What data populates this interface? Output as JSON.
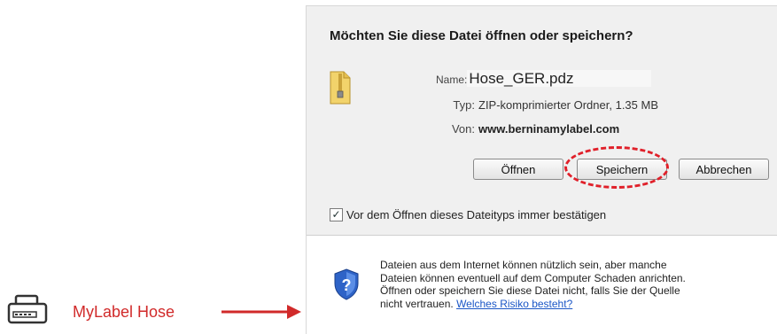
{
  "dialog": {
    "question": "Möchten Sie diese Datei öffnen oder speichern?",
    "name_label": "Name:",
    "name_value": "Hose_GER.pdz",
    "type_label": "Typ:",
    "type_value": "ZIP-komprimierter Ordner, 1.35 MB",
    "from_label": "Von:",
    "from_value": "www.berninamylabel.com",
    "buttons": {
      "open": "Öffnen",
      "save": "Speichern",
      "cancel": "Abbrechen"
    },
    "confirm_checkbox": {
      "label": "Vor dem Öffnen dieses Dateityps immer bestätigen",
      "checked": true
    },
    "warning": {
      "line1": "Dateien aus dem Internet können nützlich sein, aber manche",
      "line2": "Dateien können eventuell auf dem Computer Schaden anrichten.",
      "line3": "Öffnen oder speichern Sie diese Datei nicht, falls Sie der Quelle",
      "line4_prefix": "nicht vertrauen.",
      "risk_link": "Welches Risiko besteht?"
    },
    "icons": {
      "file": "zip-folder-icon",
      "warning": "security-shield-icon"
    }
  },
  "annotation": {
    "label": "MyLabel Hose",
    "icon": "label-printer-icon",
    "color": "#d12a2a"
  }
}
